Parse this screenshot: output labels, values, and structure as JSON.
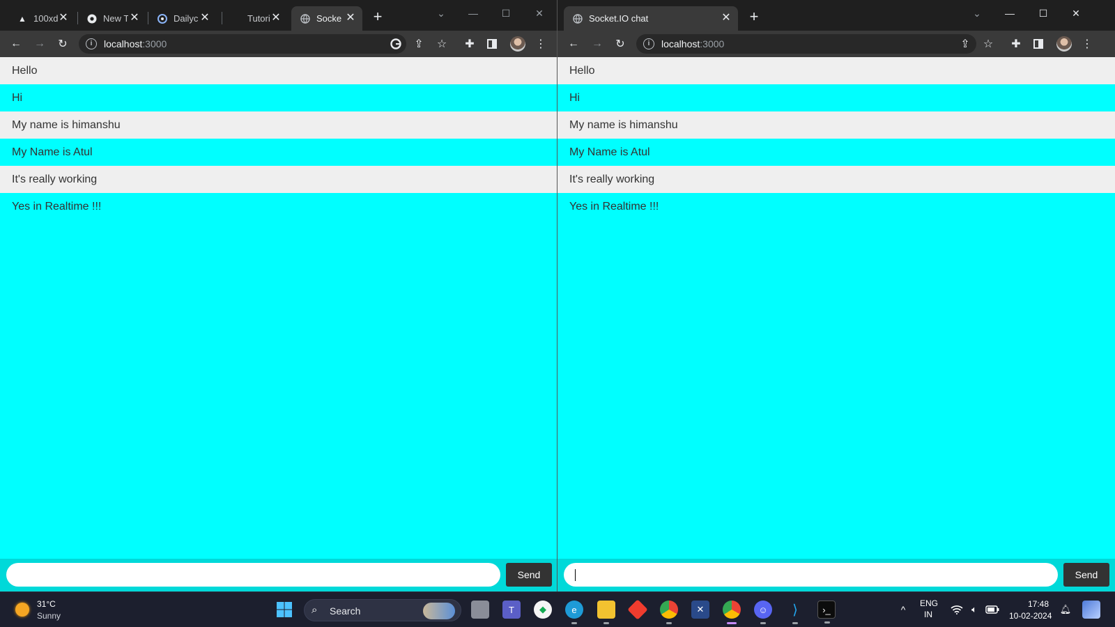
{
  "left_window": {
    "tabs": [
      {
        "title": "100xd",
        "icon": "triangle-logo-icon"
      },
      {
        "title": "New T",
        "icon": "chrome-logo-icon"
      },
      {
        "title": "Dailyc",
        "icon": "daily-logo-icon"
      },
      {
        "title": "Tutori",
        "icon": "tutorial-logo-icon"
      },
      {
        "title": "Socke",
        "icon": "globe-icon",
        "active": true
      }
    ],
    "url_host": "localhost",
    "url_port": ":3000",
    "send_label": "Send",
    "input_value": ""
  },
  "right_window": {
    "tabs": [
      {
        "title": "Socket.IO chat",
        "icon": "globe-icon",
        "active": true
      }
    ],
    "url_host": "localhost",
    "url_port": ":3000",
    "send_label": "Send",
    "input_value": ""
  },
  "messages": [
    "Hello",
    "Hi",
    "My name is himanshu",
    "My Name is Atul",
    "It's really working",
    "Yes in Realtime !!!"
  ],
  "colors": {
    "chat_background": "#00ffff",
    "odd_message_row": "#efefef",
    "send_button": "#333333",
    "chrome_dark": "#1f1f1f",
    "taskbar": "#1c1f2e"
  },
  "taskbar": {
    "weather_temp": "31°C",
    "weather_condition": "Sunny",
    "search_label": "Search",
    "language_line1": "ENG",
    "language_line2": "IN",
    "time": "17:48",
    "date": "10-02-2024",
    "apps": [
      "start-icon",
      "file-explorer-folder-icon",
      "teams-icon",
      "mongodb-compass-icon",
      "edge-icon",
      "folder-icon",
      "git-icon",
      "chrome-icon",
      "vpn-icon",
      "chrome-profile-icon",
      "discord-icon",
      "vscode-icon",
      "terminal-icon"
    ]
  }
}
